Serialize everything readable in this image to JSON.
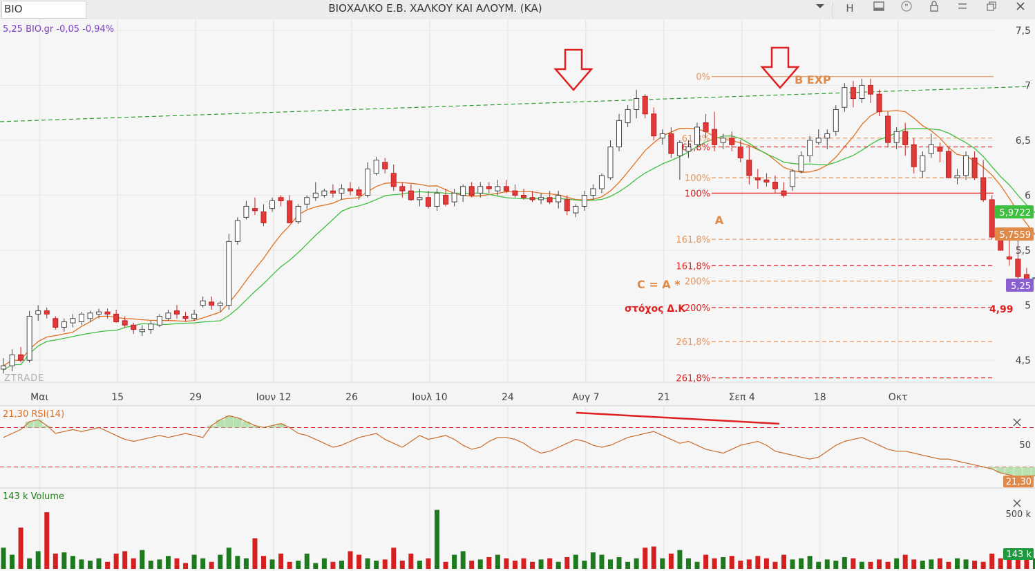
{
  "toolbar": {
    "symbol": "BIO",
    "title": "ΒΙΟΧΑΛΚΟ Ε.Β. ΧΑΛΚΟΥ ΚΑΙ ΑΛΟΥΜ. (ΚΑ)",
    "icons": [
      "dropdown-icon",
      "h-icon",
      "panel-icon",
      "quote-icon",
      "lock-icon",
      "menu-icon",
      "restore-icon",
      "close-icon"
    ],
    "h_label": "H"
  },
  "chart_data": [
    {
      "type": "candlestick",
      "legend": "5,25 BIO.gr -0,05 -0,94%",
      "legend_color": "#7b3fbf",
      "watermark": "ZTRADE",
      "ylim": [
        4.3,
        7.6
      ],
      "y_ticks": [
        "7,5",
        "7",
        "6,5",
        "6",
        "5,5",
        "5",
        "4,5"
      ],
      "y_tick_values": [
        7.5,
        7.0,
        6.5,
        6.0,
        5.5,
        5.0,
        4.5
      ],
      "x_ticks": [
        "Μαι",
        "15",
        "29",
        "Ιουν 12",
        "26",
        "Ιουλ 10",
        "24",
        "Αυγ 7",
        "21",
        "Σεπ 4",
        "18",
        "Οκτ"
      ],
      "x_tick_bar_index": [
        4,
        13,
        22,
        31,
        40,
        49,
        58,
        67,
        76,
        85,
        94,
        103
      ],
      "up_color": "#ffffff",
      "down_color": "#e03a3a",
      "ohlc": [
        [
          4.42,
          4.52,
          4.38,
          4.45
        ],
        [
          4.45,
          4.6,
          4.4,
          4.55
        ],
        [
          4.55,
          4.62,
          4.48,
          4.5
        ],
        [
          4.5,
          4.95,
          4.48,
          4.9
        ],
        [
          4.92,
          5.0,
          4.86,
          4.95
        ],
        [
          4.95,
          4.98,
          4.88,
          4.92
        ],
        [
          4.88,
          4.9,
          4.78,
          4.8
        ],
        [
          4.8,
          4.88,
          4.76,
          4.85
        ],
        [
          4.84,
          4.92,
          4.8,
          4.88
        ],
        [
          4.85,
          4.94,
          4.82,
          4.92
        ],
        [
          4.88,
          4.95,
          4.85,
          4.93
        ],
        [
          4.92,
          4.97,
          4.88,
          4.94
        ],
        [
          4.94,
          4.97,
          4.88,
          4.92
        ],
        [
          4.92,
          4.96,
          4.84,
          4.85
        ],
        [
          4.86,
          4.9,
          4.8,
          4.82
        ],
        [
          4.82,
          4.84,
          4.74,
          4.78
        ],
        [
          4.76,
          4.82,
          4.72,
          4.78
        ],
        [
          4.78,
          4.86,
          4.74,
          4.83
        ],
        [
          4.82,
          4.92,
          4.8,
          4.9
        ],
        [
          4.88,
          4.96,
          4.86,
          4.93
        ],
        [
          4.95,
          5.0,
          4.88,
          4.92
        ],
        [
          4.9,
          4.94,
          4.85,
          4.88
        ],
        [
          4.88,
          4.96,
          4.86,
          4.92
        ],
        [
          5.0,
          5.08,
          4.98,
          5.04
        ],
        [
          5.03,
          5.08,
          4.96,
          5.0
        ],
        [
          5.0,
          5.04,
          4.94,
          5.02
        ],
        [
          5.0,
          5.65,
          4.96,
          5.58
        ],
        [
          5.58,
          5.8,
          5.55,
          5.77
        ],
        [
          5.8,
          5.95,
          5.78,
          5.9
        ],
        [
          5.88,
          5.98,
          5.82,
          5.86
        ],
        [
          5.85,
          5.92,
          5.72,
          5.75
        ],
        [
          5.88,
          5.98,
          5.85,
          5.95
        ],
        [
          5.98,
          6.0,
          5.9,
          5.95
        ],
        [
          5.95,
          6.0,
          5.75,
          5.75
        ],
        [
          5.76,
          5.92,
          5.74,
          5.9
        ],
        [
          5.92,
          6.0,
          5.88,
          5.98
        ],
        [
          5.98,
          6.12,
          5.95,
          6.02
        ],
        [
          6.0,
          6.06,
          5.98,
          6.04
        ],
        [
          6.04,
          6.1,
          5.98,
          6.02
        ],
        [
          6.02,
          6.1,
          5.96,
          6.06
        ],
        [
          6.06,
          6.12,
          6.0,
          6.04
        ],
        [
          6.05,
          6.08,
          5.96,
          6.0
        ],
        [
          6.0,
          6.3,
          5.98,
          6.24
        ],
        [
          6.2,
          6.35,
          6.18,
          6.32
        ],
        [
          6.3,
          6.34,
          6.2,
          6.24
        ],
        [
          6.2,
          6.28,
          6.04,
          6.08
        ],
        [
          6.08,
          6.12,
          5.98,
          6.04
        ],
        [
          6.04,
          6.1,
          5.95,
          5.96
        ],
        [
          5.96,
          6.06,
          5.9,
          5.98
        ],
        [
          5.98,
          6.04,
          5.88,
          5.9
        ],
        [
          5.9,
          6.06,
          5.86,
          6.02
        ],
        [
          6.0,
          6.06,
          5.9,
          5.92
        ],
        [
          5.94,
          6.06,
          5.9,
          6.02
        ],
        [
          6.0,
          6.1,
          5.94,
          6.08
        ],
        [
          6.08,
          6.12,
          5.98,
          6.0
        ],
        [
          6.02,
          6.12,
          5.98,
          6.08
        ],
        [
          6.08,
          6.12,
          6.02,
          6.06
        ],
        [
          6.04,
          6.14,
          6.0,
          6.08
        ],
        [
          6.08,
          6.14,
          6.02,
          6.04
        ],
        [
          6.04,
          6.1,
          5.98,
          6.0
        ],
        [
          6.0,
          6.06,
          5.96,
          5.98
        ],
        [
          5.98,
          6.04,
          5.94,
          5.96
        ],
        [
          5.96,
          6.02,
          5.92,
          5.98
        ],
        [
          5.98,
          6.04,
          5.92,
          5.94
        ],
        [
          5.94,
          6.04,
          5.88,
          6.0
        ],
        [
          5.96,
          6.0,
          5.82,
          5.86
        ],
        [
          5.84,
          5.92,
          5.8,
          5.9
        ],
        [
          5.9,
          6.04,
          5.86,
          6.0
        ],
        [
          6.0,
          6.1,
          5.96,
          6.06
        ],
        [
          6.06,
          6.2,
          6.02,
          6.18
        ],
        [
          6.16,
          6.5,
          6.14,
          6.44
        ],
        [
          6.44,
          6.74,
          6.4,
          6.68
        ],
        [
          6.66,
          6.82,
          6.62,
          6.78
        ],
        [
          6.78,
          6.96,
          6.7,
          6.88
        ],
        [
          6.9,
          6.92,
          6.7,
          6.74
        ],
        [
          6.74,
          6.8,
          6.5,
          6.54
        ],
        [
          6.52,
          6.6,
          6.46,
          6.56
        ],
        [
          6.56,
          6.62,
          6.34,
          6.38
        ],
        [
          6.36,
          6.5,
          6.14,
          6.48
        ],
        [
          6.4,
          6.5,
          6.34,
          6.44
        ],
        [
          6.46,
          6.66,
          6.42,
          6.62
        ],
        [
          6.66,
          6.74,
          6.52,
          6.58
        ],
        [
          6.6,
          6.76,
          6.4,
          6.46
        ],
        [
          6.48,
          6.56,
          6.42,
          6.52
        ],
        [
          6.52,
          6.58,
          6.4,
          6.46
        ],
        [
          6.44,
          6.5,
          6.3,
          6.34
        ],
        [
          6.32,
          6.44,
          6.1,
          6.18
        ],
        [
          6.16,
          6.24,
          6.06,
          6.14
        ],
        [
          6.14,
          6.2,
          6.08,
          6.12
        ],
        [
          6.12,
          6.18,
          6.02,
          6.06
        ],
        [
          6.04,
          6.12,
          5.98,
          6.0
        ],
        [
          6.08,
          6.24,
          6.04,
          6.22
        ],
        [
          6.22,
          6.4,
          6.2,
          6.36
        ],
        [
          6.36,
          6.54,
          6.3,
          6.5
        ],
        [
          6.48,
          6.6,
          6.46,
          6.52
        ],
        [
          6.52,
          6.6,
          6.42,
          6.56
        ],
        [
          6.58,
          6.82,
          6.54,
          6.78
        ],
        [
          6.8,
          7.02,
          6.76,
          6.98
        ],
        [
          6.98,
          7.04,
          6.8,
          6.88
        ],
        [
          6.88,
          7.06,
          6.84,
          7.0
        ],
        [
          7.0,
          7.06,
          6.84,
          6.92
        ],
        [
          6.92,
          6.96,
          6.72,
          6.76
        ],
        [
          6.72,
          6.76,
          6.44,
          6.48
        ],
        [
          6.48,
          6.62,
          6.42,
          6.58
        ],
        [
          6.58,
          6.66,
          6.36,
          6.46
        ],
        [
          6.46,
          6.52,
          6.2,
          6.26
        ],
        [
          6.22,
          6.4,
          6.16,
          6.36
        ],
        [
          6.38,
          6.56,
          6.34,
          6.46
        ],
        [
          6.44,
          6.48,
          6.3,
          6.4
        ],
        [
          6.4,
          6.44,
          6.16,
          6.16
        ],
        [
          6.16,
          6.24,
          6.1,
          6.18
        ],
        [
          6.18,
          6.4,
          6.14,
          6.36
        ],
        [
          6.34,
          6.4,
          6.14,
          6.16
        ],
        [
          6.16,
          6.32,
          5.94,
          5.96
        ],
        [
          5.96,
          6.0,
          5.6,
          5.62
        ],
        [
          5.62,
          5.64,
          5.5,
          5.5
        ],
        [
          5.44,
          5.6,
          5.36,
          5.42
        ],
        [
          5.42,
          5.64,
          5.2,
          5.26
        ],
        [
          5.28,
          5.34,
          5.18,
          5.22
        ],
        [
          5.25,
          5.3,
          5.14,
          5.25
        ]
      ],
      "annotations": [
        {
          "text": "A",
          "color": "#e08a4a"
        },
        {
          "text": "B EXP",
          "color": "#e08a4a"
        },
        {
          "text": "C = A *",
          "color": "#e08a4a"
        },
        {
          "text": "στόχος Δ.Κ",
          "color": "#e02020"
        },
        {
          "text": "4,99",
          "color": "#e02020"
        }
      ],
      "fib_levels_orange": [
        {
          "label": "0%",
          "value": 7.08
        },
        {
          "label": "61,8%",
          "value": 6.52
        },
        {
          "label": "100%",
          "value": 6.16
        },
        {
          "label": "161,8%",
          "value": 5.6
        },
        {
          "label": "200%",
          "value": 5.22
        },
        {
          "label": "261,8%",
          "value": 4.67
        }
      ],
      "fib_levels_red": [
        {
          "label": "61,8%",
          "value": 6.44
        },
        {
          "label": "100%",
          "value": 6.02
        },
        {
          "label": "161,8%",
          "value": 5.36
        },
        {
          "label": "200%",
          "value": 4.98
        },
        {
          "label": "261,8%",
          "value": 4.34
        }
      ],
      "price_labels": [
        {
          "text": "5,9722",
          "color": "#3fbf3f"
        },
        {
          "text": "5,7559",
          "color": "#e08a4a"
        },
        {
          "text": "5,25",
          "color": "#8a5fd0"
        }
      ],
      "trendline_color": "#2a9a2a"
    },
    {
      "type": "line",
      "legend": "21,30 RSI(14)",
      "legend_color": "#e07020",
      "y_tick": "50",
      "current_label": "21,30",
      "overbought": 70,
      "oversold": 30,
      "ylim": [
        10,
        90
      ],
      "values": [
        60,
        64,
        68,
        76,
        78,
        72,
        64,
        66,
        68,
        66,
        68,
        70,
        66,
        62,
        58,
        56,
        58,
        60,
        62,
        60,
        62,
        64,
        62,
        60,
        72,
        78,
        82,
        80,
        76,
        72,
        70,
        72,
        74,
        70,
        64,
        62,
        58,
        54,
        50,
        52,
        56,
        60,
        62,
        64,
        58,
        54,
        50,
        56,
        62,
        58,
        60,
        62,
        58,
        52,
        48,
        50,
        56,
        60,
        60,
        58,
        54,
        48,
        44,
        46,
        50,
        54,
        58,
        56,
        52,
        50,
        52,
        56,
        60,
        62,
        64,
        66,
        62,
        58,
        54,
        56,
        52,
        48,
        46,
        44,
        48,
        52,
        54,
        56,
        52,
        46,
        44,
        42,
        40,
        38,
        40,
        46,
        52,
        56,
        58,
        60,
        56,
        52,
        48,
        46,
        46,
        44,
        42,
        40,
        38,
        38,
        36,
        34,
        32,
        30,
        28,
        24,
        22,
        20,
        21,
        21
      ],
      "trend_line_color": "#e02020"
    },
    {
      "type": "bar",
      "legend": "143 k Volume",
      "legend_color": "#1e7a1e",
      "y_tick": "500 k",
      "current_label": "143 k",
      "ylim": [
        0,
        650
      ],
      "values": [
        180,
        120,
        350,
        90,
        150,
        480,
        130,
        140,
        110,
        80,
        70,
        90,
        60,
        130,
        150,
        90,
        160,
        70,
        80,
        110,
        90,
        50,
        120,
        90,
        60,
        120,
        180,
        110,
        90,
        260,
        110,
        80,
        130,
        60,
        70,
        130,
        50,
        90,
        60,
        70,
        150,
        120,
        90,
        70,
        80,
        180,
        70,
        130,
        70,
        90,
        500,
        60,
        120,
        150,
        70,
        80,
        100,
        120,
        90,
        70,
        90,
        60,
        80,
        90,
        60,
        100,
        120,
        70,
        140,
        120,
        80,
        100,
        60,
        90,
        180,
        190,
        90,
        130,
        160,
        90,
        60,
        120,
        90,
        100,
        110,
        70,
        80,
        110,
        90,
        60,
        120,
        80,
        90,
        110,
        60,
        80,
        70,
        100,
        90,
        60,
        60,
        80,
        60,
        90,
        120,
        80,
        70,
        80,
        90,
        60,
        90,
        80,
        70,
        60,
        130,
        90,
        120,
        130,
        130,
        90
      ]
    }
  ]
}
